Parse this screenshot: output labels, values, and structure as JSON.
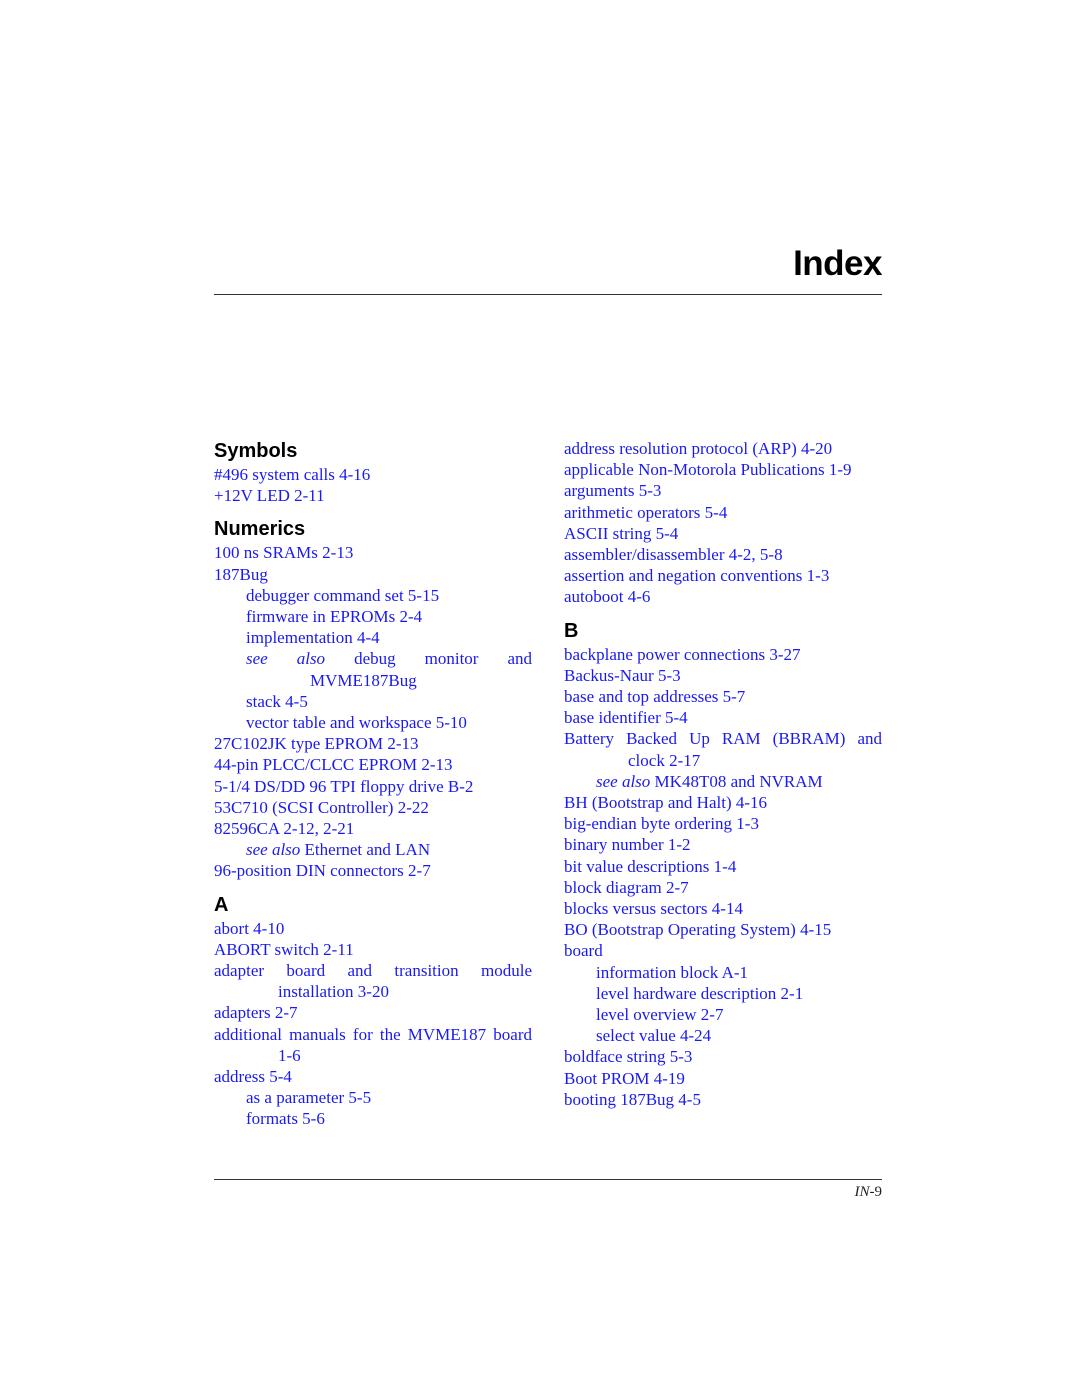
{
  "page": {
    "title": "Index",
    "folio_prefix": "IN",
    "folio_number": "-9"
  },
  "colors": {
    "link": "#1a1aee",
    "heading": "#000000"
  },
  "left_column": {
    "symbols": {
      "heading": "Symbols",
      "entries": [
        "#496 system calls 4-16",
        "+12V LED 2-11"
      ]
    },
    "numerics": {
      "heading": "Numerics",
      "e0": "100 ns SRAMs 2-13",
      "e1": "187Bug",
      "e1_sub0": "debugger command set 5-15",
      "e1_sub1": "firmware in EPROMs 2-4",
      "e1_sub2": "implementation 4-4",
      "e1_sub3_see": "see also",
      "e1_sub3_text": "debug monitor and MVME187Bug",
      "e1_sub4": "stack 4-5",
      "e1_sub5": "vector table and workspace 5-10",
      "e2": "27C102JK type EPROM 2-13",
      "e3": "44-pin PLCC/CLCC EPROM 2-13",
      "e4": "5-1/4 DS/DD 96 TPI floppy drive B-2",
      "e5": "53C710 (SCSI Controller) 2-22",
      "e6": "82596CA 2-12, 2-21",
      "e6_sub0_see": "see also",
      "e6_sub0_text": "Ethernet and LAN",
      "e7": "96-position DIN connectors 2-7"
    },
    "a": {
      "heading": "A",
      "e0": "abort 4-10",
      "e1": "ABORT switch 2-11",
      "e2": "adapter board and transition module installation 3-20",
      "e3": "adapters 2-7",
      "e4": "additional manuals for the MVME187 board 1-6",
      "e5": "address 5-4",
      "e5_sub0": "as a parameter 5-5",
      "e5_sub1": "formats 5-6"
    }
  },
  "right_column": {
    "a_cont": {
      "e0": "address resolution protocol (ARP) 4-20",
      "e1": "applicable Non-Motorola Publications 1-9",
      "e2": "arguments 5-3",
      "e3": "arithmetic operators 5-4",
      "e4": "ASCII string 5-4",
      "e5": "assembler/disassembler 4-2, 5-8",
      "e6": "assertion and negation conventions 1-3",
      "e7": "autoboot 4-6"
    },
    "b": {
      "heading": "B",
      "e0": "backplane power connections 3-27",
      "e1": "Backus-Naur 5-3",
      "e2": "base and top addresses 5-7",
      "e3": "base identifier 5-4",
      "e4": "Battery Backed Up RAM (BBRAM) and clock 2-17",
      "e4_sub0_see": "see also",
      "e4_sub0_text": "MK48T08 and NVRAM",
      "e5": "BH (Bootstrap and Halt) 4-16",
      "e6": "big-endian byte ordering 1-3",
      "e7": "binary number 1-2",
      "e8": "bit value descriptions 1-4",
      "e9": "block diagram 2-7",
      "e10": "blocks versus sectors 4-14",
      "e11": "BO (Bootstrap Operating System) 4-15",
      "e12": "board",
      "e12_sub0": "information block A-1",
      "e12_sub1": "level hardware description 2-1",
      "e12_sub2": "level overview 2-7",
      "e12_sub3": "select value 4-24",
      "e13": "boldface string 5-3",
      "e14": "Boot PROM 4-19",
      "e15": "booting 187Bug 4-5"
    }
  }
}
